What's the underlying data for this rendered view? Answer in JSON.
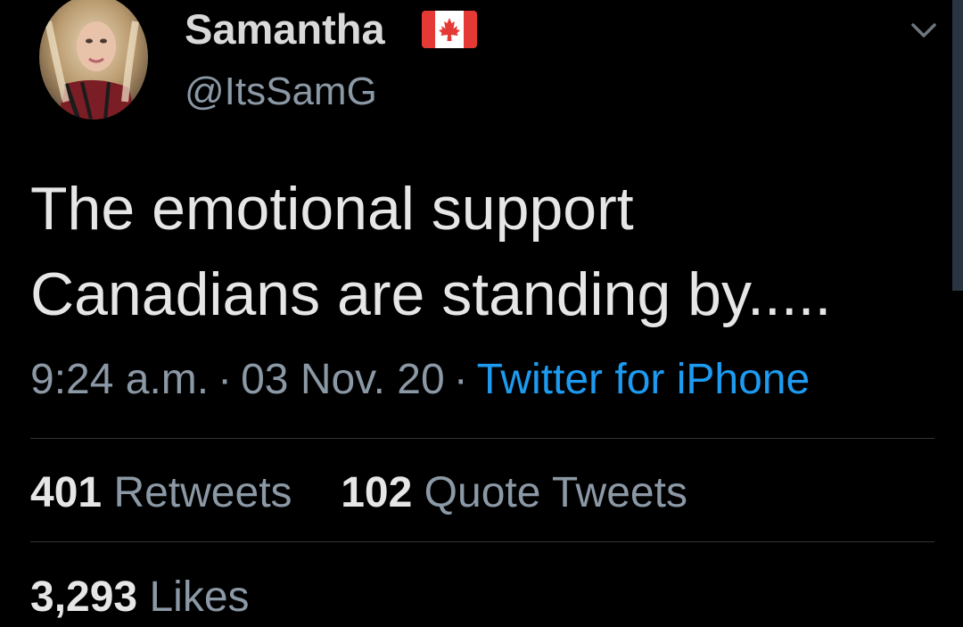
{
  "author": {
    "display_name": "Samantha",
    "handle": "@ItsSamG",
    "flag_icon": "canada-flag-icon"
  },
  "tweet": {
    "text_lines": [
      "The emotional support",
      "Canadians are standing by....."
    ],
    "time": "9:24 a.m.",
    "date": "03 Nov. 20",
    "separator": "·",
    "source": "Twitter for iPhone"
  },
  "stats": {
    "retweets_count": "401",
    "retweets_label": "Retweets",
    "quotes_count": "102",
    "quotes_label": "Quote Tweets",
    "likes_count": "3,293",
    "likes_label": "Likes"
  },
  "colors": {
    "background": "#000000",
    "primary_text": "#e6e6e6",
    "secondary_text": "#8b98a5",
    "link": "#1d9bf0",
    "divider": "#2f3336",
    "flag_red": "#e53935"
  },
  "icons": {
    "menu": "chevron-down-icon",
    "avatar": "avatar"
  }
}
